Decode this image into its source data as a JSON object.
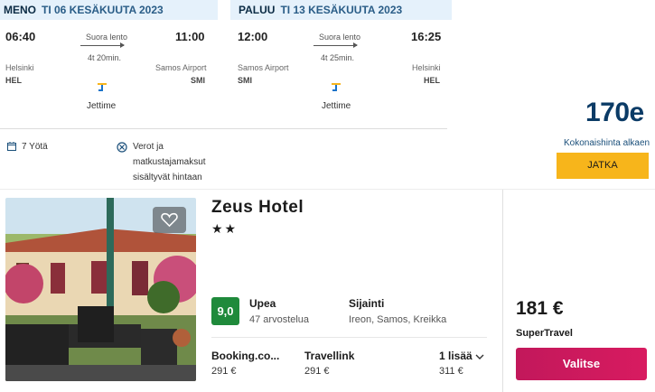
{
  "outbound": {
    "direction": "MENO",
    "date": "TI 06 KESÄKUUTA 2023",
    "depart_time": "06:40",
    "arrive_time": "11:00",
    "flight_type": "Suora lento",
    "duration": "4t 20min.",
    "from_city": "Helsinki",
    "from_code": "HEL",
    "to_city": "Samos Airport",
    "to_code": "SMI",
    "airline": "Jettime"
  },
  "inbound": {
    "direction": "PALUU",
    "date": "TI 13 KESÄKUUTA 2023",
    "depart_time": "12:00",
    "arrive_time": "16:25",
    "flight_type": "Suora lento",
    "duration": "4t 25min.",
    "from_city": "Samos Airport",
    "from_code": "SMI",
    "to_city": "Helsinki",
    "to_code": "HEL",
    "airline": "Jettime"
  },
  "trip_info": {
    "nights": "7 Yötä",
    "taxes_line1": "Verot ja",
    "taxes_line2": "matkustajamaksut",
    "taxes_line3": "sisältyvät hintaan"
  },
  "summary": {
    "total_price": "170e",
    "total_label": "Kokonaishinta alkaen",
    "continue_label": "JATKA"
  },
  "hotel": {
    "name": "Zeus Hotel",
    "stars": "★★",
    "score": "9,0",
    "rating_word": "Upea",
    "review_count": "47 arvostelua",
    "location_label": "Sijainti",
    "location_value": "Ireon, Samos, Kreikka",
    "providers": [
      {
        "name": "Booking.co...",
        "price": "291 €"
      },
      {
        "name": "Travellink",
        "price": "291 €"
      }
    ],
    "more_label": "1 lisää",
    "more_price": "311 €",
    "best_price": "181 €",
    "best_provider": "SuperTravel",
    "select_label": "Valitse"
  },
  "colors": {
    "header_bg": "#e5f1fb",
    "accent_yellow": "#f7b51b",
    "price_blue": "#0b3b66",
    "score_green": "#1f8a3b",
    "select_pink": "#d81b60"
  }
}
